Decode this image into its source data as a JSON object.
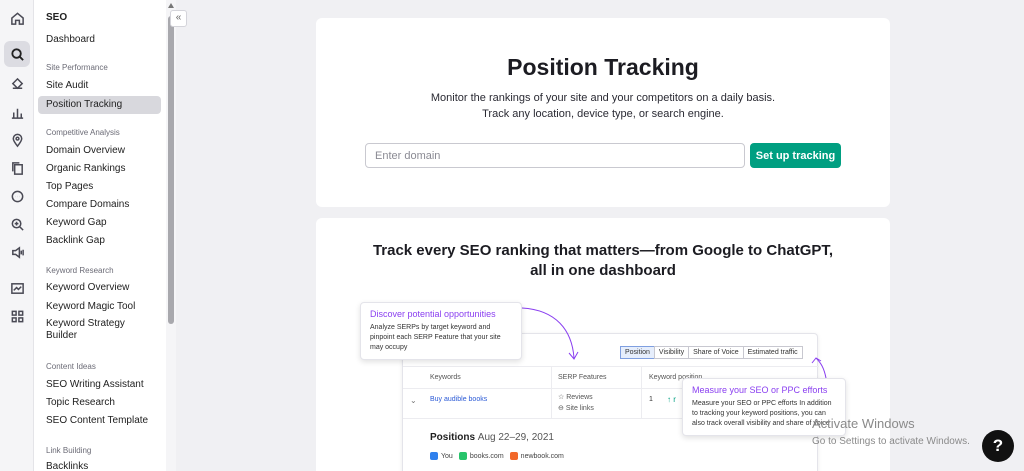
{
  "rail": {
    "icons": [
      "home-icon",
      "seo-icon",
      "local-icon",
      "chart-icon",
      "location-icon",
      "content-icon",
      "chat-icon",
      "ai-icon",
      "ads-icon",
      "trends-icon",
      "apps-icon"
    ]
  },
  "sidebar": {
    "title": "SEO",
    "dashboard": "Dashboard",
    "sections": {
      "site_performance": "Site Performance",
      "competitive_analysis": "Competitive Analysis",
      "keyword_research": "Keyword Research",
      "content_ideas": "Content Ideas",
      "link_building": "Link Building"
    },
    "items": {
      "site_audit": "Site Audit",
      "position_tracking": "Position Tracking",
      "domain_overview": "Domain Overview",
      "organic_rankings": "Organic Rankings",
      "top_pages": "Top Pages",
      "compare_domains": "Compare Domains",
      "keyword_gap": "Keyword Gap",
      "backlink_gap": "Backlink Gap",
      "keyword_overview": "Keyword Overview",
      "keyword_magic_tool": "Keyword Magic Tool",
      "keyword_strategy_builder": "Keyword Strategy Builder",
      "seo_writing_assistant": "SEO Writing Assistant",
      "topic_research": "Topic Research",
      "seo_content_template": "SEO Content Template",
      "backlinks": "Backlinks"
    },
    "collapse_glyph": "«"
  },
  "hero": {
    "title": "Position Tracking",
    "subtitle_line1": "Monitor the rankings of your site and your competitors on a daily basis.",
    "subtitle_line2": "Track any location, device type, or search engine.",
    "domain_input": {
      "value": "",
      "placeholder": "Enter domain"
    },
    "cta": "Set up tracking"
  },
  "promo": {
    "heading_line1": "Track every SEO ranking that matters—from Google to ChatGPT,",
    "heading_line2": "all in one dashboard",
    "tip1": {
      "title": "Discover potential opportunities",
      "body": "Analyze SERPs by target keyword and pinpoint each SERP Feature that your site may occupy"
    },
    "tip2": {
      "title": "Measure your SEO or PPC efforts",
      "body": "Measure your SEO or PPC efforts In addition to tracking your keyword positions, you can also track overall visibility and share of voice"
    },
    "mock": {
      "tabs": [
        "Position",
        "Visibility",
        "Share of Voice",
        "Estimated traffic"
      ],
      "columns": [
        "Keywords",
        "SERP Features",
        "Keyword position"
      ],
      "row": {
        "keyword": "Buy audible books",
        "features": [
          "Reviews",
          "Site links"
        ],
        "position": "1",
        "position_tail": "r"
      },
      "positions_label": "Positions",
      "positions_dates": "Aug 22–29, 2021",
      "legend": [
        {
          "label": "You",
          "color": "#2f80ed"
        },
        {
          "label": "books.com",
          "color": "#27c46b"
        },
        {
          "label": "newbook.com",
          "color": "#f2682a"
        }
      ]
    }
  },
  "overlay": {
    "activate_title": "Activate Windows",
    "activate_sub": "Go to Settings to activate Windows.",
    "help": "?"
  }
}
